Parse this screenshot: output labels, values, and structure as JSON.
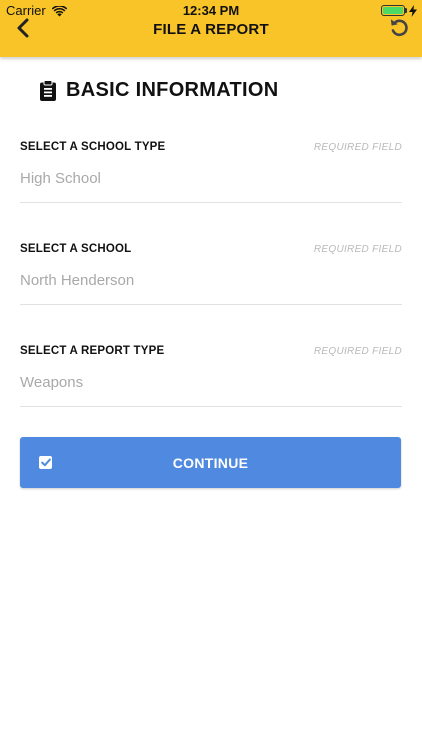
{
  "status_bar": {
    "carrier": "Carrier",
    "time": "12:34 PM",
    "wifi_icon": "wifi-icon",
    "battery_icon": "battery-icon",
    "charging_icon": "bolt-icon",
    "battery_level": 1.0
  },
  "header": {
    "title": "FILE A REPORT",
    "back_icon": "chevron-left-icon",
    "reset_icon": "undo-icon",
    "background_color": "#f8c427"
  },
  "section": {
    "icon": "clipboard-icon",
    "title": "BASIC INFORMATION"
  },
  "fields": [
    {
      "label": "SELECT A SCHOOL TYPE",
      "required": "REQUIRED FIELD",
      "value": "High School"
    },
    {
      "label": "SELECT A SCHOOL",
      "required": "REQUIRED FIELD",
      "value": "North Henderson"
    },
    {
      "label": "SELECT A REPORT TYPE",
      "required": "REQUIRED FIELD",
      "value": "Weapons"
    }
  ],
  "continue_button": {
    "label": "CONTINUE",
    "icon": "checkbox-checked-icon",
    "color": "#4f8ae0"
  }
}
